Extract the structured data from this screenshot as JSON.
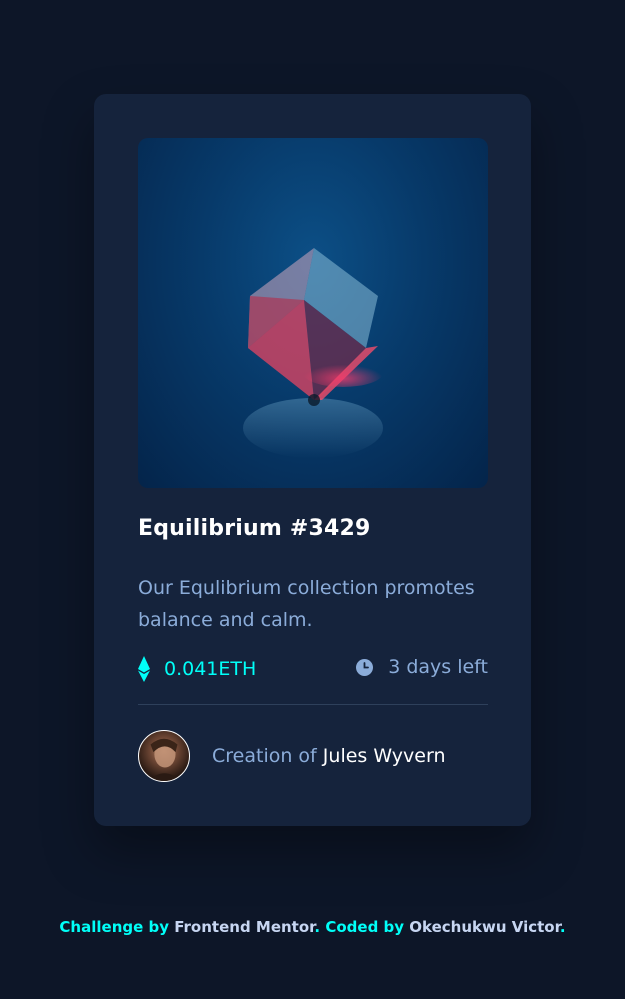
{
  "card": {
    "image_alt": "equilibrium-cube",
    "title": "Equilibrium #3429",
    "description": "Our Equlibrium collection promotes balance and calm.",
    "price": "0.041ETH",
    "time_left": "3 days left",
    "creation_prefix": "Creation of",
    "creator_name": "Jules Wyvern"
  },
  "footer": {
    "challenge_by": "Challenge by",
    "frontend_mentor": "Frontend Mentor",
    "sep1": ". ",
    "coded_by": "Coded by",
    "author": "Okechukwu Victor",
    "end": "."
  },
  "colors": {
    "background": "#0d1628",
    "card": "#15233c",
    "accent": "#00fff8",
    "muted": "#8bacd9",
    "white": "#ffffff"
  }
}
